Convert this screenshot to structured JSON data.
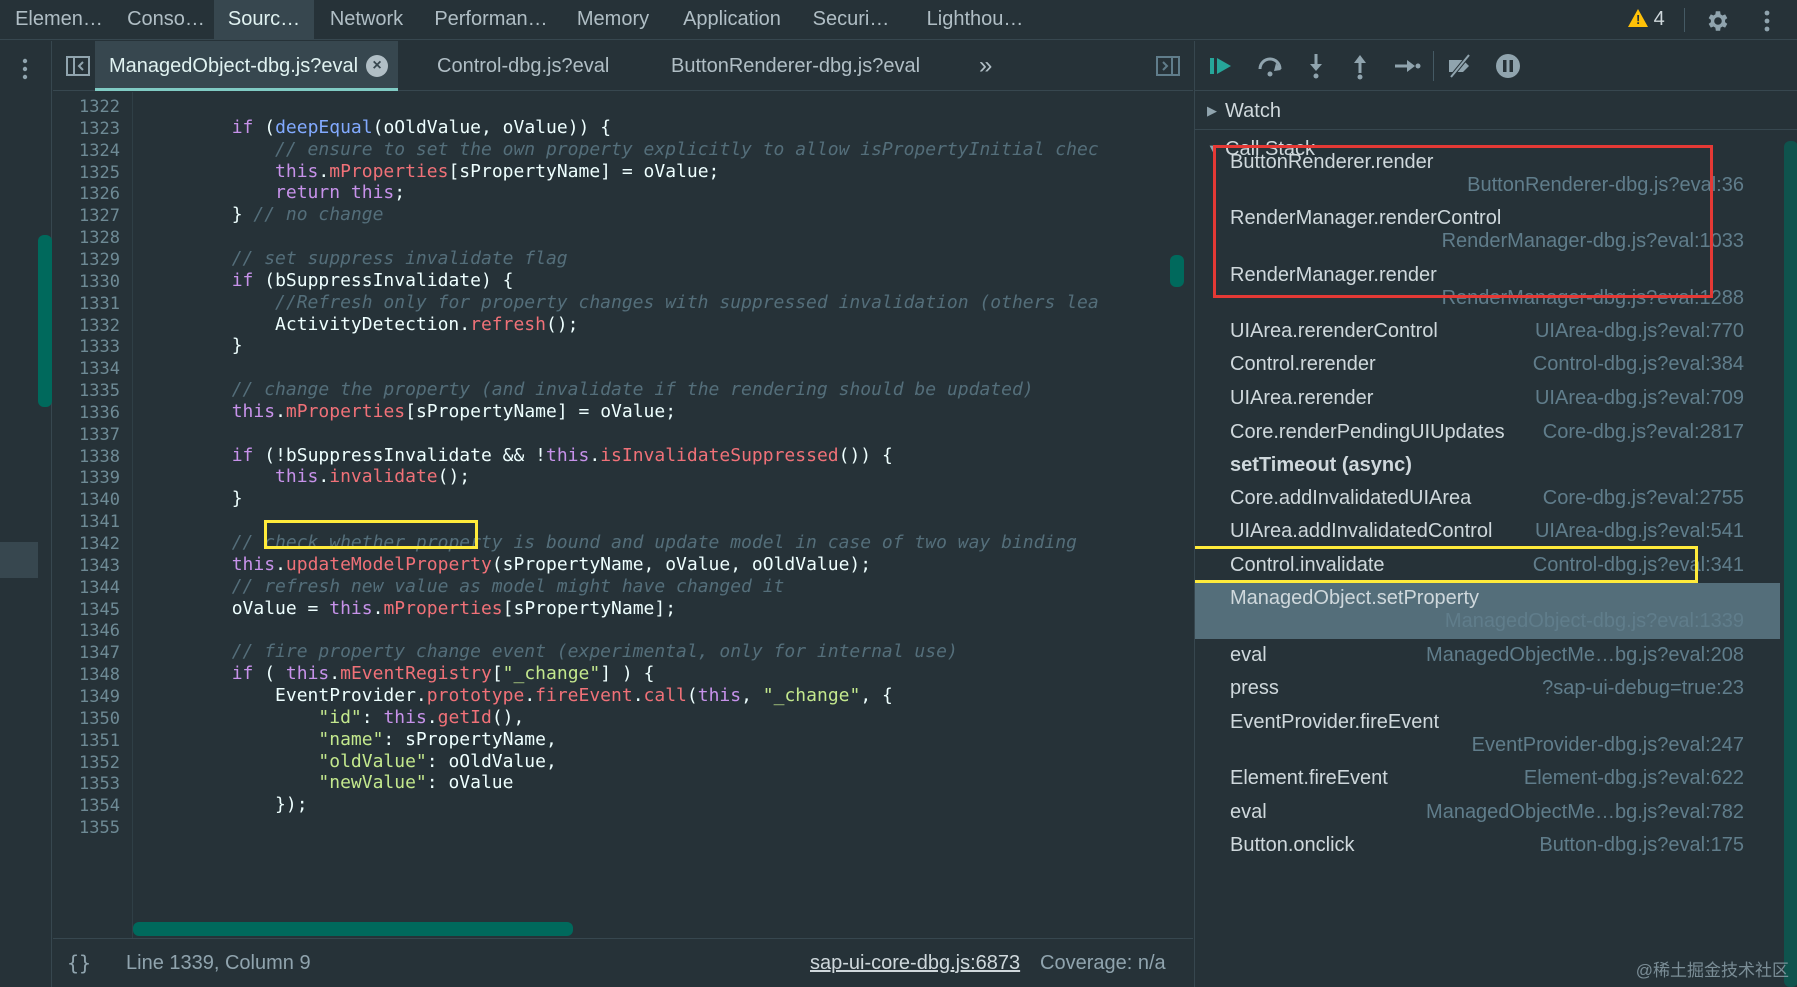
{
  "panel_tabs": [
    "Elemen…",
    "Conso…",
    "Sourc…",
    "Network",
    "Performan…",
    "Memory",
    "Application",
    "Securi…",
    "Lighthou…"
  ],
  "active_panel": "Sourc…",
  "warnings_count": "4",
  "file_tabs": [
    "ManagedObject-dbg.js?eval",
    "Control-dbg.js?eval",
    "ButtonRenderer-dbg.js?eval"
  ],
  "more_tabs": "»",
  "code_lines": [
    {
      "n": "1322",
      "code": ""
    },
    {
      "n": "1323",
      "code": "        if (deepEqual(oOldValue, oValue)) {"
    },
    {
      "n": "1324",
      "code": "            // ensure to set the own property explicitly to allow isPropertyInitial chec"
    },
    {
      "n": "1325",
      "code": "            this.mProperties[sPropertyName] = oValue;"
    },
    {
      "n": "1326",
      "code": "            return this;"
    },
    {
      "n": "1327",
      "code": "        } // no change"
    },
    {
      "n": "1328",
      "code": ""
    },
    {
      "n": "1329",
      "code": "        // set suppress invalidate flag"
    },
    {
      "n": "1330",
      "code": "        if (bSuppressInvalidate) {"
    },
    {
      "n": "1331",
      "code": "            //Refresh only for property changes with suppressed invalidation (others lea"
    },
    {
      "n": "1332",
      "code": "            ActivityDetection.refresh();"
    },
    {
      "n": "1333",
      "code": "        }"
    },
    {
      "n": "1334",
      "code": ""
    },
    {
      "n": "1335",
      "code": "        // change the property (and invalidate if the rendering should be updated)"
    },
    {
      "n": "1336",
      "code": "        this.mProperties[sPropertyName] = oValue;"
    },
    {
      "n": "1337",
      "code": ""
    },
    {
      "n": "1338",
      "code": "        if (!bSuppressInvalidate && !this.isInvalidateSuppressed()) {"
    },
    {
      "n": "1339",
      "code": "            this.invalidate();"
    },
    {
      "n": "1340",
      "code": "        }"
    },
    {
      "n": "1341",
      "code": ""
    },
    {
      "n": "1342",
      "code": "        // check whether property is bound and update model in case of two way binding"
    },
    {
      "n": "1343",
      "code": "        this.updateModelProperty(sPropertyName, oValue, oOldValue);"
    },
    {
      "n": "1344",
      "code": "        // refresh new value as model might have changed it"
    },
    {
      "n": "1345",
      "code": "        oValue = this.mProperties[sPropertyName];"
    },
    {
      "n": "1346",
      "code": ""
    },
    {
      "n": "1347",
      "code": "        // fire property change event (experimental, only for internal use)"
    },
    {
      "n": "1348",
      "code": "        if ( this.mEventRegistry[\"_change\"] ) {"
    },
    {
      "n": "1349",
      "code": "            EventProvider.prototype.fireEvent.call(this, \"_change\", {"
    },
    {
      "n": "1350",
      "code": "                \"id\": this.getId(),"
    },
    {
      "n": "1351",
      "code": "                \"name\": sPropertyName,"
    },
    {
      "n": "1352",
      "code": "                \"oldValue\": oOldValue,"
    },
    {
      "n": "1353",
      "code": "                \"newValue\": oValue"
    },
    {
      "n": "1354",
      "code": "            });"
    },
    {
      "n": "1355",
      "code": ""
    }
  ],
  "status": {
    "position": "Line 1339, Column 9",
    "source_link": "sap-ui-core-dbg.js:6873",
    "coverage": "Coverage: n/a"
  },
  "watch_label": "Watch",
  "callstack_label": "Call Stack",
  "call_stack": [
    {
      "name": "ButtonRenderer.render",
      "loc": "ButtonRenderer-dbg.js?eval:36"
    },
    {
      "name": "RenderManager.renderControl",
      "loc": "RenderManager-dbg.js?eval:1033"
    },
    {
      "name": "RenderManager.render",
      "loc": "RenderManager-dbg.js?eval:1288"
    },
    {
      "name": "UIArea.rerenderControl",
      "loc": "UIArea-dbg.js?eval:770"
    },
    {
      "name": "Control.rerender",
      "loc": "Control-dbg.js?eval:384"
    },
    {
      "name": "UIArea.rerender",
      "loc": "UIArea-dbg.js?eval:709"
    },
    {
      "name": "Core.renderPendingUIUpdates",
      "loc": "Core-dbg.js?eval:2817"
    },
    {
      "name": "setTimeout (async)",
      "loc": ""
    },
    {
      "name": "Core.addInvalidatedUIArea",
      "loc": "Core-dbg.js?eval:2755"
    },
    {
      "name": "UIArea.addInvalidatedControl",
      "loc": "UIArea-dbg.js?eval:541"
    },
    {
      "name": "Control.invalidate",
      "loc": "Control-dbg.js?eval:341"
    },
    {
      "name": "ManagedObject.setProperty",
      "loc": "ManagedObject-dbg.js?eval:1339"
    },
    {
      "name": "eval",
      "loc": "ManagedObjectMe…bg.js?eval:208"
    },
    {
      "name": "press",
      "loc": "?sap-ui-debug=true:23"
    },
    {
      "name": "EventProvider.fireEvent",
      "loc": "EventProvider-dbg.js?eval:247"
    },
    {
      "name": "Element.fireEvent",
      "loc": "Element-dbg.js?eval:622"
    },
    {
      "name": "eval",
      "loc": "ManagedObjectMe…bg.js?eval:782"
    },
    {
      "name": "Button.onclick",
      "loc": "Button-dbg.js?eval:175"
    }
  ],
  "watermark": "@稀土掘金技术社区"
}
